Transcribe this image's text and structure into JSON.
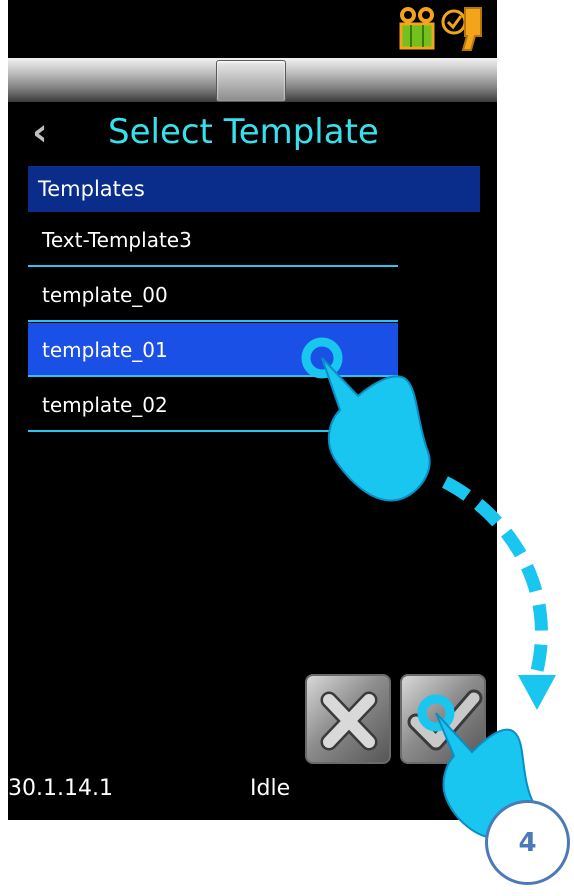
{
  "header": {
    "title": "Select Template"
  },
  "list": {
    "header": "Templates",
    "items": [
      {
        "label": "Text-Template3",
        "selected": false
      },
      {
        "label": "template_00",
        "selected": false
      },
      {
        "label": "template_01",
        "selected": true
      },
      {
        "label": "template_02",
        "selected": false
      }
    ]
  },
  "status": {
    "version": "30.1.14.1",
    "state": "Idle"
  },
  "actions": {
    "cancel_icon": "x-icon",
    "confirm_icon": "check-icon"
  },
  "annotation": {
    "step": "4"
  },
  "colors": {
    "title": "#38e0ee",
    "list_header_bg": "#0a2c8a",
    "selected_bg": "#1a50e6",
    "divider": "#2bc6ee",
    "gesture": "#19c6f0",
    "callout_border": "#4a7ab8"
  }
}
